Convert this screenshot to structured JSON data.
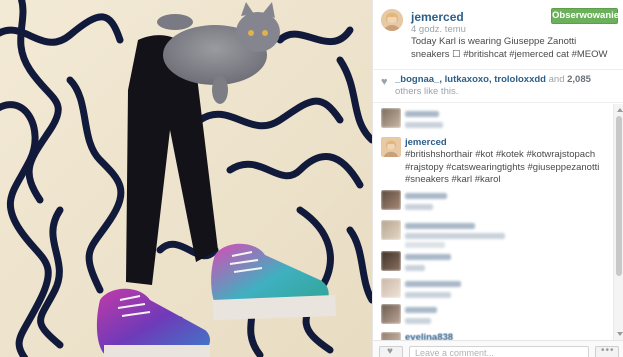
{
  "post": {
    "username": "jemerced",
    "time": "4 godz. temu",
    "caption": "Today Karl is wearing Giuseppe Zanotti sneakers ☐ #britishcat #jemerced  cat #MEOW",
    "follow_label": "Obserwowanie"
  },
  "likes": {
    "users": "_bognaa_, lutkaxoxo, trololoxxdd",
    "connector": "and",
    "count": "2,085",
    "suffix": "others like this."
  },
  "comments": [
    {
      "type": "blurred"
    },
    {
      "type": "owner",
      "username": "jemerced",
      "text": "#britishshorthair #kot #kotek #kotwrajstopach #rajstopy #catswearingtights #giuseppezanotti #sneakers #karl #karol"
    },
    {
      "type": "blurred"
    },
    {
      "type": "blurred"
    },
    {
      "type": "blurred"
    },
    {
      "type": "blurred"
    },
    {
      "type": "blurred"
    },
    {
      "type": "blurred",
      "partial_name": "evelina838"
    }
  ],
  "footer": {
    "comment_placeholder": "Leave a comment..."
  },
  "icons": {
    "heart": "heart-icon",
    "like": "like-heart-icon",
    "more": "more-options-icon"
  },
  "colors": {
    "accent": "#2b5f8a",
    "follow_button": "#6bb05a",
    "muted_text": "#9aa3ab"
  }
}
